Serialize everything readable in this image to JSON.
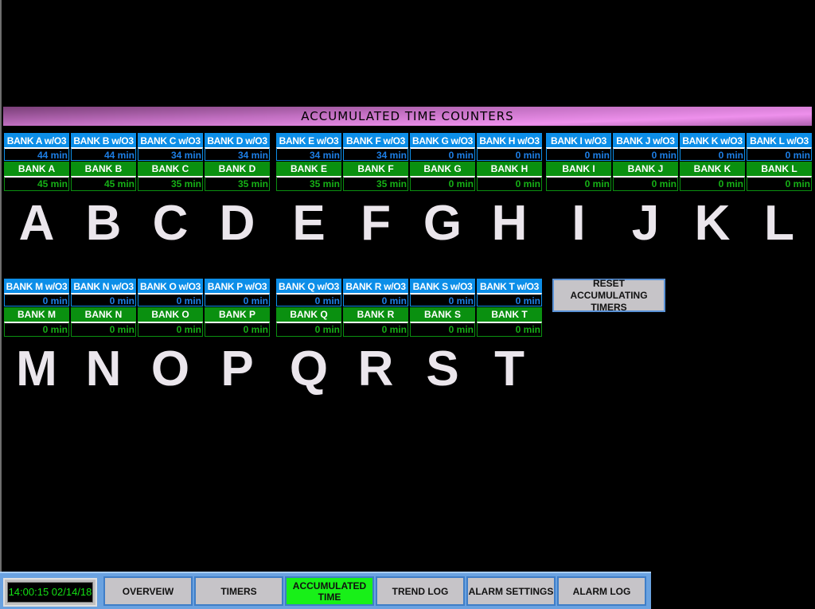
{
  "title": "ACCUMULATED TIME COUNTERS",
  "colors": {
    "header_blue": "#0c8ee8",
    "value_blue": "#1d7fe6",
    "header_green": "#0a9010",
    "value_green": "#16b016",
    "active_nav": "#18f018",
    "title_bar": "#ee90ec"
  },
  "banks_row1": [
    {
      "letter": "A",
      "o3_label": "BANK A w/O3",
      "o3_value": "44 min",
      "label": "BANK A",
      "value": "45 min"
    },
    {
      "letter": "B",
      "o3_label": "BANK B w/O3",
      "o3_value": "44 min",
      "label": "BANK B",
      "value": "45 min"
    },
    {
      "letter": "C",
      "o3_label": "BANK C w/O3",
      "o3_value": "34 min",
      "label": "BANK C",
      "value": "35 min"
    },
    {
      "letter": "D",
      "o3_label": "BANK D w/O3",
      "o3_value": "34 min",
      "label": "BANK D",
      "value": "35 min"
    },
    {
      "letter": "E",
      "o3_label": "BANK E w/O3",
      "o3_value": "34 min",
      "label": "BANK E",
      "value": "35 min"
    },
    {
      "letter": "F",
      "o3_label": "BANK F w/O3",
      "o3_value": "34 min",
      "label": "BANK F",
      "value": "35 min"
    },
    {
      "letter": "G",
      "o3_label": "BANK G w/O3",
      "o3_value": "0 min",
      "label": "BANK G",
      "value": "0 min"
    },
    {
      "letter": "H",
      "o3_label": "BANK H w/O3",
      "o3_value": "0 min",
      "label": "BANK H",
      "value": "0 min"
    },
    {
      "letter": "I",
      "o3_label": "BANK I w/O3",
      "o3_value": "0 min",
      "label": "BANK I",
      "value": "0 min"
    },
    {
      "letter": "J",
      "o3_label": "BANK J w/O3",
      "o3_value": "0 min",
      "label": "BANK J",
      "value": "0 min"
    },
    {
      "letter": "K",
      "o3_label": "BANK K w/O3",
      "o3_value": "0 min",
      "label": "BANK K",
      "value": "0 min"
    },
    {
      "letter": "L",
      "o3_label": "BANK L w/O3",
      "o3_value": "0 min",
      "label": "BANK L",
      "value": "0 min"
    }
  ],
  "banks_row2": [
    {
      "letter": "M",
      "o3_label": "BANK M w/O3",
      "o3_value": "0 min",
      "label": "BANK M",
      "value": "0 min"
    },
    {
      "letter": "N",
      "o3_label": "BANK N w/O3",
      "o3_value": "0 min",
      "label": "BANK N",
      "value": "0 min"
    },
    {
      "letter": "O",
      "o3_label": "BANK O w/O3",
      "o3_value": "0 min",
      "label": "BANK O",
      "value": "0 min"
    },
    {
      "letter": "P",
      "o3_label": "BANK P w/O3",
      "o3_value": "0 min",
      "label": "BANK P",
      "value": "0 min"
    },
    {
      "letter": "Q",
      "o3_label": "BANK Q w/O3",
      "o3_value": "0 min",
      "label": "BANK Q",
      "value": "0 min"
    },
    {
      "letter": "R",
      "o3_label": "BANK R w/O3",
      "o3_value": "0 min",
      "label": "BANK R",
      "value": "0 min"
    },
    {
      "letter": "S",
      "o3_label": "BANK S w/O3",
      "o3_value": "0 min",
      "label": "BANK S",
      "value": "0 min"
    },
    {
      "letter": "T",
      "o3_label": "BANK T w/O3",
      "o3_value": "0 min",
      "label": "BANK T",
      "value": "0 min"
    }
  ],
  "reset_button": "RESET ACCUMULATING TIMERS",
  "navbar": {
    "clock": "14:00:15 02/14/18",
    "buttons": [
      {
        "label": "OVERVEIW",
        "active": false
      },
      {
        "label": "TIMERS",
        "active": false
      },
      {
        "label": "ACCUMULATED TIME",
        "active": true
      },
      {
        "label": "TREND LOG",
        "active": false
      },
      {
        "label": "ALARM SETTINGS",
        "active": false
      },
      {
        "label": "ALARM LOG",
        "active": false
      }
    ]
  }
}
